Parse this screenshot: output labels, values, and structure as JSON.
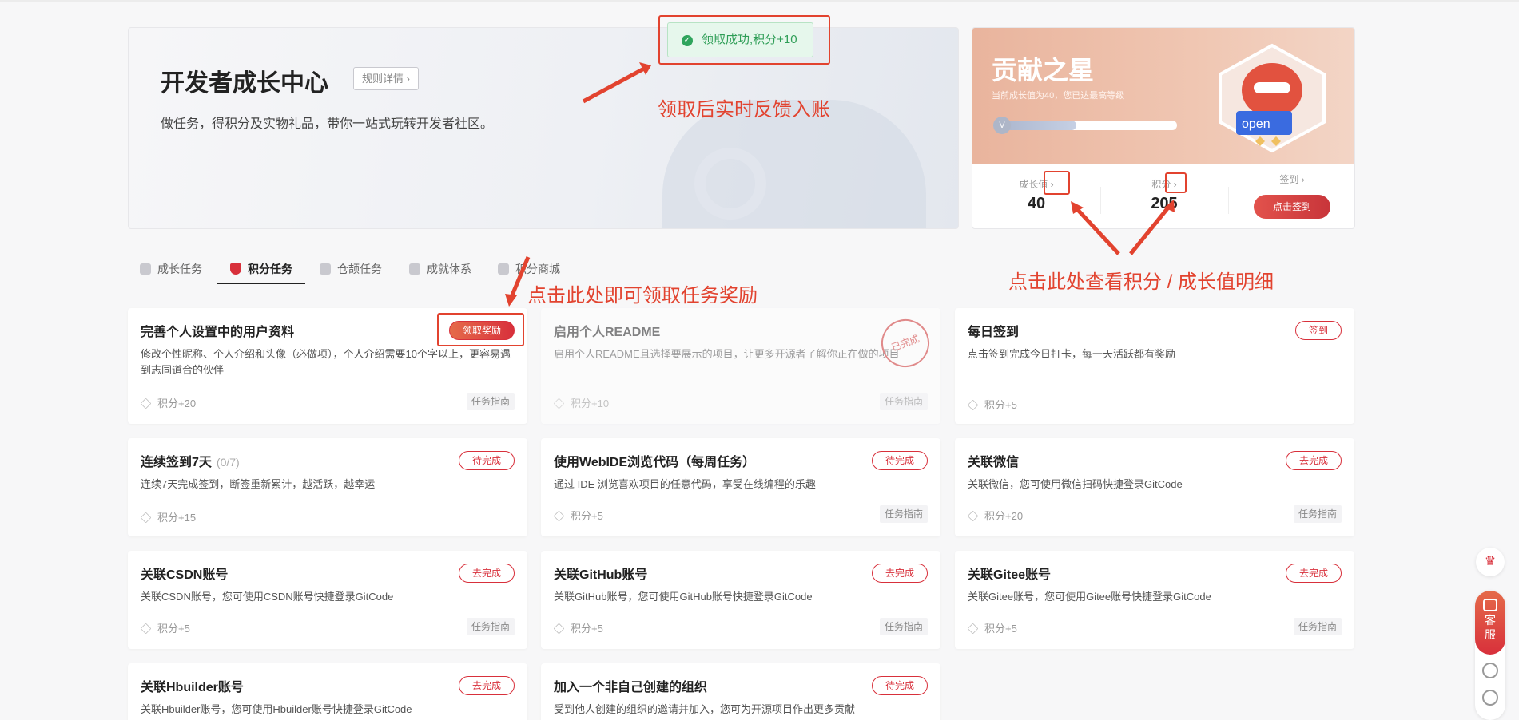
{
  "hero": {
    "title": "开发者成长中心",
    "rule_label": "规则详情",
    "subtitle": "做任务，得积分及实物礼品，带你一站式玩转开发者社区。"
  },
  "toast": {
    "text": "领取成功,积分+10"
  },
  "star_card": {
    "title": "贡献之星",
    "desc": "当前成长值为40，您已达最高等级",
    "level_badge": "V",
    "progress": 0.45,
    "stats": [
      {
        "label": "成长值",
        "value": "40"
      },
      {
        "label": "积分",
        "value": "205"
      },
      {
        "label": "签到",
        "value": ""
      }
    ],
    "sign_button": "点击签到"
  },
  "tabs": [
    {
      "label": "成长任务",
      "active": false
    },
    {
      "label": "积分任务",
      "active": true
    },
    {
      "label": "仓颉任务",
      "active": false
    },
    {
      "label": "成就体系",
      "active": false
    },
    {
      "label": "积分商城",
      "active": false
    }
  ],
  "cards": [
    {
      "title": "完善个人设置中的用户资料",
      "count": "",
      "desc": "修改个性昵称、个人介绍和头像（必做项），个人介绍需要10个字以上，更容易遇到志同道合的伙伴",
      "points": "积分+20",
      "guide": "任务指南",
      "button": "领取奖励"
    },
    {
      "title": "启用个人README",
      "count": "",
      "desc": "启用个人README且选择要展示的项目，让更多开源者了解你正在做的项目",
      "points": "积分+10",
      "guide": "任务指南",
      "button": "",
      "stamp": "已完成"
    },
    {
      "title": "每日签到",
      "count": "",
      "desc": "点击签到完成今日打卡，每一天活跃都有奖励",
      "points": "积分+5",
      "guide": "",
      "button": "签到"
    },
    {
      "title": "连续签到7天",
      "count": "(0/7)",
      "desc": "连续7天完成签到，断签重新累计，越活跃，越幸运",
      "points": "积分+15",
      "guide": "",
      "button": "待完成"
    },
    {
      "title": "使用WebIDE浏览代码（每周任务）",
      "count": "",
      "desc": "通过 IDE 浏览喜欢项目的任意代码，享受在线编程的乐趣",
      "points": "积分+5",
      "guide": "任务指南",
      "button": "待完成"
    },
    {
      "title": "关联微信",
      "count": "",
      "desc": "关联微信，您可使用微信扫码快捷登录GitCode",
      "points": "积分+20",
      "guide": "任务指南",
      "button": "去完成"
    },
    {
      "title": "关联CSDN账号",
      "count": "",
      "desc": "关联CSDN账号，您可使用CSDN账号快捷登录GitCode",
      "points": "积分+5",
      "guide": "任务指南",
      "button": "去完成"
    },
    {
      "title": "关联GitHub账号",
      "count": "",
      "desc": "关联GitHub账号，您可使用GitHub账号快捷登录GitCode",
      "points": "积分+5",
      "guide": "任务指南",
      "button": "去完成"
    },
    {
      "title": "关联Gitee账号",
      "count": "",
      "desc": "关联Gitee账号，您可使用Gitee账号快捷登录GitCode",
      "points": "积分+5",
      "guide": "任务指南",
      "button": "去完成"
    },
    {
      "title": "关联Hbuilder账号",
      "count": "",
      "desc": "关联Hbuilder账号，您可使用Hbuilder账号快捷登录GitCode",
      "points": "",
      "guide": "",
      "button": "去完成"
    },
    {
      "title": "加入一个非自己创建的组织",
      "count": "",
      "desc": "受到他人创建的组织的邀请并加入，您可为开源项目作出更多贡献",
      "points": "",
      "guide": "",
      "button": "待完成"
    }
  ],
  "annotations": {
    "toast_note": "领取后实时反馈入账",
    "reward_note": "点击此处即可领取任务奖励",
    "detail_note": "点击此处查看积分 / 成长值明细"
  },
  "floating": {
    "service_label_1": "客",
    "service_label_2": "服"
  },
  "colors": {
    "accent": "#d8303b",
    "annotation": "#e2432f",
    "success": "#2fa45c"
  }
}
